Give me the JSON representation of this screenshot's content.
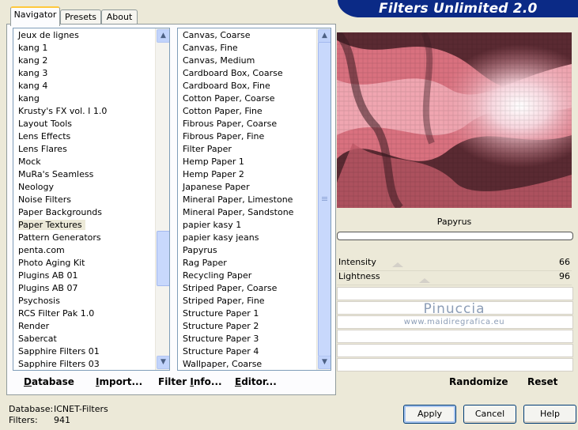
{
  "header": {
    "title": "Filters Unlimited 2.0"
  },
  "tabs": [
    {
      "label": "Navigator",
      "active": true
    },
    {
      "label": "Presets",
      "active": false
    },
    {
      "label": "About",
      "active": false
    }
  ],
  "categories": {
    "items": [
      "Jeux de lignes",
      "kang 1",
      "kang 2",
      "kang 3",
      "kang 4",
      "kang",
      "Krusty's FX vol. I 1.0",
      "Layout Tools",
      "Lens Effects",
      "Lens Flares",
      "Mock",
      "MuRa's Seamless",
      "Neology",
      "Noise Filters",
      "Paper Backgrounds",
      "Paper Textures",
      "Pattern Generators",
      "penta.com",
      "Photo Aging Kit",
      "Plugins AB 01",
      "Plugins AB 07",
      "Psychosis",
      "RCS Filter Pak 1.0",
      "Render",
      "Sabercat",
      "Sapphire Filters 01",
      "Sapphire Filters 03"
    ],
    "selected": "Paper Textures"
  },
  "filters": {
    "items": [
      "Canvas, Coarse",
      "Canvas, Fine",
      "Canvas, Medium",
      "Cardboard Box, Coarse",
      "Cardboard Box, Fine",
      "Cotton Paper, Coarse",
      "Cotton Paper, Fine",
      "Fibrous Paper, Coarse",
      "Fibrous Paper, Fine",
      "Filter Paper",
      "Hemp Paper 1",
      "Hemp Paper 2",
      "Japanese Paper",
      "Mineral Paper, Limestone",
      "Mineral Paper, Sandstone",
      "papier kasy 1",
      "papier kasy jeans",
      "Papyrus",
      "Rag Paper",
      "Recycling Paper",
      "Striped Paper, Coarse",
      "Striped Paper, Fine",
      "Structure Paper 1",
      "Structure Paper 2",
      "Structure Paper 3",
      "Structure Paper 4",
      "Wallpaper, Coarse"
    ],
    "selected": "Papyrus"
  },
  "list_buttons": {
    "database": {
      "ul": "D",
      "rest": "atabase"
    },
    "import": {
      "ul": "I",
      "rest": "mport..."
    },
    "filter_info": {
      "pre": "Filter ",
      "ul": "I",
      "rest": "nfo..."
    },
    "editor": {
      "ul": "E",
      "rest": "ditor..."
    }
  },
  "preview": {
    "filter_name": "Papyrus"
  },
  "sliders": [
    {
      "label": "Intensity",
      "value": "66"
    },
    {
      "label": "Lightness",
      "value": "96"
    }
  ],
  "watermark": {
    "name": "Pinuccia",
    "site": "www.maidiregrafica.eu"
  },
  "actions": {
    "randomize": "Randomize",
    "reset": "Reset"
  },
  "status": {
    "database_label": "Database:",
    "database_value": "ICNET-Filters",
    "filters_label": "Filters:",
    "filters_value": "941"
  },
  "dialog_buttons": {
    "apply": "Apply",
    "cancel": "Cancel",
    "help": "Help"
  },
  "colors": {
    "banner": "#0b2a86",
    "selection": "#316ac5",
    "tab_highlight": "#ffc83c"
  },
  "icons": {
    "scroll_up": "scroll-up-arrow-icon",
    "scroll_down": "scroll-down-arrow-icon"
  }
}
